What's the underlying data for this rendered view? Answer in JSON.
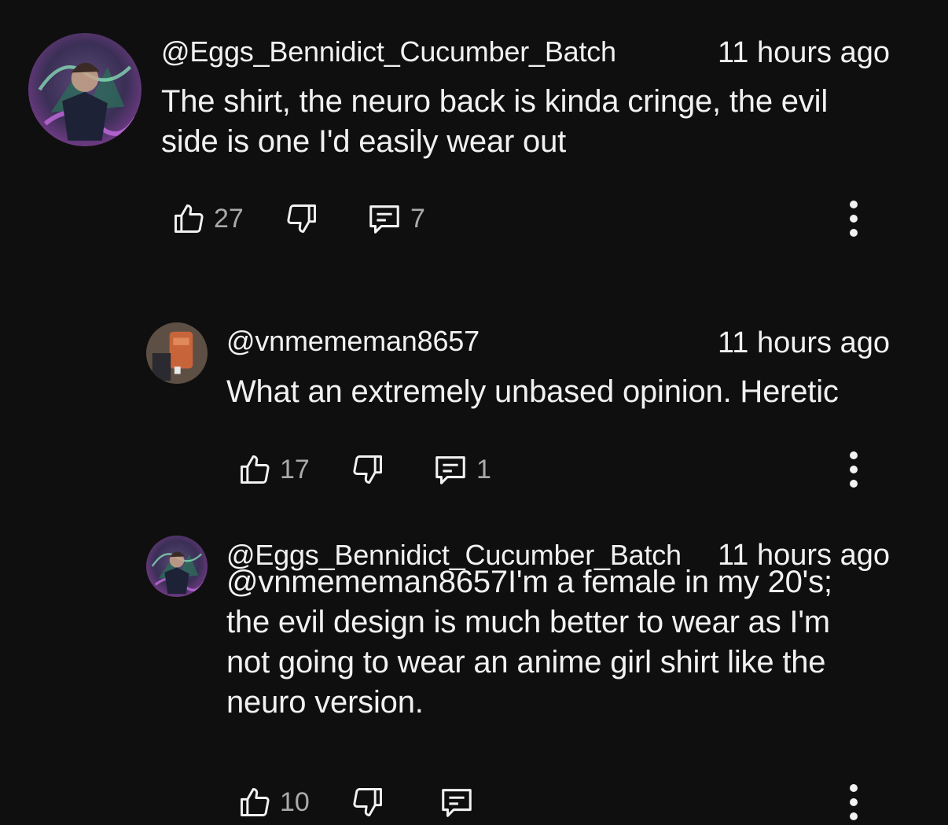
{
  "colors": {
    "background": "#0f0f0f",
    "text_primary": "#f1f1f1",
    "text_secondary": "#aaaaaa"
  },
  "comments": [
    {
      "author": "@Eggs_Bennidict_Cucumber_Batch",
      "time": "11 hours ago",
      "text": "The shirt, the neuro back is kinda cringe, the evil side is one I'd easily wear out",
      "likes": "27",
      "replies": "7",
      "avatar_icon": "avatar-anime-art-icon"
    },
    {
      "author": "@vnmememan8657",
      "time": "11 hours ago",
      "text": "What an extremely unbased opinion. Heretic",
      "likes": "17",
      "replies": "1",
      "avatar_icon": "avatar-photo-icon"
    },
    {
      "author": "@Eggs_Bennidict_Cucumber_Batch",
      "time": "11 hours ago",
      "text": "@vnmememan8657I'm a female in my 20's; the evil design is much better to wear as I'm not going to wear an anime girl shirt like the neuro version.",
      "likes": "10",
      "replies": "",
      "avatar_icon": "avatar-anime-art-icon"
    }
  ]
}
